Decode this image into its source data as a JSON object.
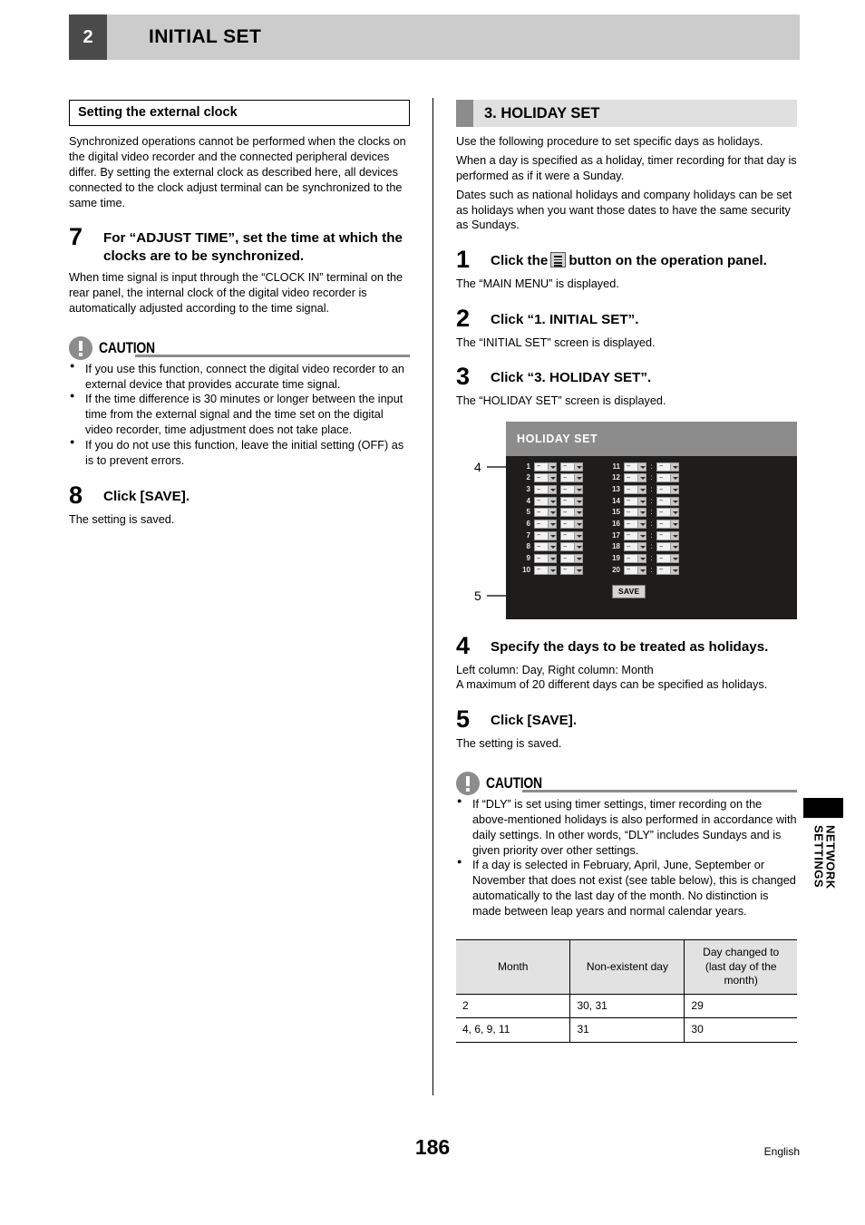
{
  "header": {
    "chapter_number": "2",
    "chapter_title": "INITIAL SET"
  },
  "left_column": {
    "subhead": "Setting the external clock",
    "intro": "Synchronized operations cannot be performed when the clocks on the digital video recorder and the connected peripheral devices differ. By setting the external clock as described here, all devices connected to the clock adjust terminal can be synchronized to the same time.",
    "step7": {
      "number": "7",
      "title": "For “ADJUST TIME”, set the time at which the clocks are to be synchronized.",
      "body": "When time signal is input through the “CLOCK IN” terminal on the rear panel, the internal clock of the digital video recorder is automatically adjusted according to the time signal."
    },
    "caution": {
      "label": "CAUTION",
      "items": [
        "If you use this function, connect the digital video recorder to an external device that provides accurate time signal.",
        "If the time difference is 30 minutes or longer between the input time from the external signal and the time set on the digital video recorder, time adjustment does not take place.",
        "If you do not use this function, leave the initial setting (OFF) as is to prevent errors."
      ]
    },
    "step8": {
      "number": "8",
      "title": "Click [SAVE].",
      "body": "The setting is saved."
    }
  },
  "right_column": {
    "section_title": "3. HOLIDAY SET",
    "intro": "Use the following procedure to set specific days as holidays. When a day is specified as a holiday, timer recording for that day is performed as if it were a Sunday.\nDates such as national holidays and company holidays can be set as holidays when you want those dates to have the same security as Sundays.",
    "intro_line1": "Use the following procedure to set specific days as holidays.",
    "intro_line2": "When a day is specified as a holiday, timer recording for that day is performed as if it were a Sunday.",
    "intro_line3": "Dates such as national holidays and company holidays can be set as holidays when you want those dates to have the same security as Sundays.",
    "step1": {
      "number": "1",
      "title_before": "Click the",
      "title_after": "button on the operation panel.",
      "icon": "menu-button-icon",
      "body": "The “MAIN MENU” is displayed."
    },
    "step2": {
      "number": "2",
      "title": "Click “1. INITIAL SET”.",
      "body": "The “INITIAL SET” screen is displayed."
    },
    "step3": {
      "number": "3",
      "title": "Click “3. HOLIDAY SET”.",
      "body": "The “HOLIDAY SET” screen is displayed."
    },
    "step4": {
      "number": "4",
      "title": "Specify the days to be treated as holidays.",
      "body_line1": "Left column: Day, Right column: Month",
      "body_line2": "A maximum of 20 different days can be specified as holidays."
    },
    "step5": {
      "number": "5",
      "title": "Click [SAVE].",
      "body": "The setting is saved."
    },
    "caution": {
      "label": "CAUTION",
      "items": [
        "If “DLY” is set using timer settings, timer recording on the above-mentioned holidays is also performed in accordance with daily settings. In other words, “DLY” includes Sundays and is given priority over other settings.",
        "If a day is selected in February, April, June, September or November that does not exist (see table below), this is changed automatically to the last day of the month. No distinction is made between leap years and normal calendar years."
      ]
    },
    "month_table": {
      "headers": [
        "Month",
        "Non-existent day",
        "Day changed to (last day of the month)"
      ],
      "header3_line1": "Day changed to",
      "header3_line2": "(last day of the",
      "header3_line3": "month)",
      "rows": [
        [
          "2",
          "30, 31",
          "29"
        ],
        [
          "4, 6, 9, 11",
          "31",
          "30"
        ]
      ]
    }
  },
  "screen_mock": {
    "title": "HOLIDAY SET",
    "save_button": "SAVE",
    "placeholder_value": "--",
    "colon": ":",
    "left_rows": [
      "1",
      "2",
      "3",
      "4",
      "5",
      "6",
      "7",
      "8",
      "9",
      "10"
    ],
    "right_rows": [
      "11",
      "12",
      "13",
      "14",
      "15",
      "16",
      "17",
      "18",
      "19",
      "20"
    ],
    "callout_grid": "4",
    "callout_save": "5"
  },
  "side_tab": {
    "text": "NETWORK\nSETTINGS"
  },
  "footer": {
    "page_number": "186",
    "language": "English"
  },
  "colors": {
    "chapter_num_bg": "#4a4a4a",
    "chapter_bar_bg": "#cccccc",
    "section_head_bg": "#e0e0e0",
    "section_tab_bg": "#8c8c8c",
    "screen_bg": "#1f1c1c",
    "screen_titlebar_bg": "#8c8c8c",
    "table_header_bg": "#e2e2e2",
    "caution_icon_bg": "#8c8c8c"
  }
}
